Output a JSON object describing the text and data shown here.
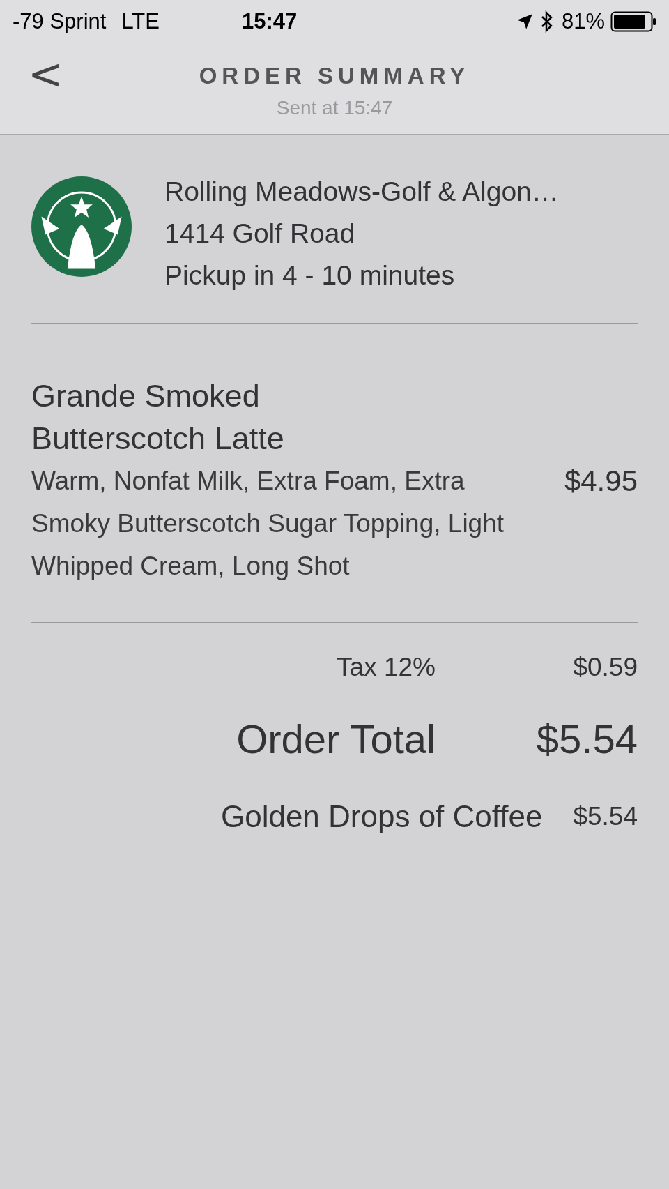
{
  "status_bar": {
    "carrier": "-79 Sprint",
    "network": "LTE",
    "time": "15:47",
    "battery": "81%"
  },
  "header": {
    "back": "<",
    "title": "ORDER SUMMARY",
    "subtitle": "Sent at 15:47"
  },
  "store": {
    "name": "Rolling Meadows-Golf & Algon…",
    "address": "1414 Golf Road",
    "pickup": "Pickup in 4 - 10 minutes"
  },
  "items": [
    {
      "name": "Grande Smoked Butterscotch Latte",
      "details": "Warm, Nonfat Milk, Extra Foam, Extra Smoky Butterscotch Sugar Topping, Light Whipped Cream, Long Shot",
      "price": "$4.95"
    }
  ],
  "totals": [
    {
      "kind": "tax",
      "label": "Tax 12%",
      "amount": "$0.59"
    },
    {
      "kind": "total",
      "label": "Order Total",
      "amount": "$5.54"
    },
    {
      "kind": "payment",
      "label": "Golden Drops of Coffee",
      "amount": "$5.54"
    }
  ]
}
